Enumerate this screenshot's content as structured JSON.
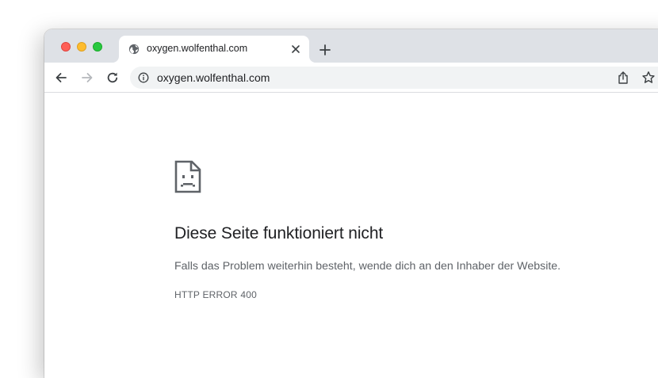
{
  "tab": {
    "title": "oxygen.wolfenthal.com",
    "favicon_icon": "globe-icon"
  },
  "omnibox": {
    "url": "oxygen.wolfenthal.com",
    "security_icon": "info-icon"
  },
  "error": {
    "icon": "sad-document-icon",
    "title": "Diese Seite funktioniert nicht",
    "description": "Falls das Problem weiterhin besteht, wende dich an den Inhaber der Website.",
    "code": "HTTP ERROR 400"
  },
  "colors": {
    "titlebar": "#dee1e6",
    "omnibox": "#f1f3f4",
    "close_light": "#fe5f57",
    "minimize_light": "#febc2e",
    "maximize_light": "#28c840",
    "text_primary": "#202124",
    "text_secondary": "#5f6368"
  }
}
